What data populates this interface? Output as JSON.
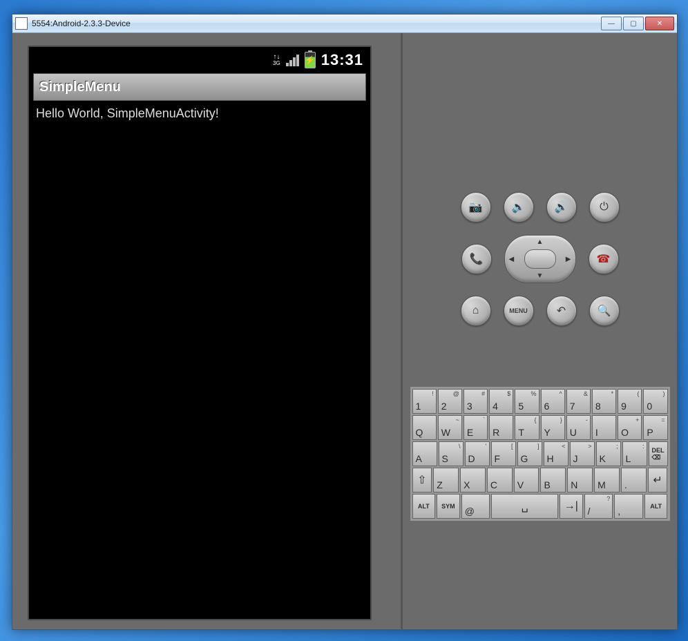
{
  "window": {
    "title": "5554:Android-2.3.3-Device"
  },
  "status": {
    "network_label": "3G",
    "clock": "13:31"
  },
  "app": {
    "title": "SimpleMenu",
    "body_text": "Hello World, SimpleMenuActivity!"
  },
  "hw": {
    "row1": [
      "camera",
      "vol-down",
      "vol-up",
      "power"
    ],
    "row3": [
      "home",
      "menu",
      "back",
      "search"
    ],
    "menu_label": "MENU"
  },
  "keyboard": {
    "row1": [
      {
        "m": "1",
        "s": "!"
      },
      {
        "m": "2",
        "s": "@"
      },
      {
        "m": "3",
        "s": "#"
      },
      {
        "m": "4",
        "s": "$"
      },
      {
        "m": "5",
        "s": "%"
      },
      {
        "m": "6",
        "s": "^"
      },
      {
        "m": "7",
        "s": "&"
      },
      {
        "m": "8",
        "s": "*"
      },
      {
        "m": "9",
        "s": "("
      },
      {
        "m": "0",
        "s": ")"
      }
    ],
    "row2": [
      {
        "m": "Q",
        "s": ""
      },
      {
        "m": "W",
        "s": "~"
      },
      {
        "m": "E",
        "s": "`"
      },
      {
        "m": "R",
        "s": ""
      },
      {
        "m": "T",
        "s": "{"
      },
      {
        "m": "Y",
        "s": "}"
      },
      {
        "m": "U",
        "s": "-"
      },
      {
        "m": "I",
        "s": ""
      },
      {
        "m": "O",
        "s": "+"
      },
      {
        "m": "P",
        "s": "="
      }
    ],
    "row3": [
      {
        "m": "A",
        "s": ""
      },
      {
        "m": "S",
        "s": "\\"
      },
      {
        "m": "D",
        "s": "'"
      },
      {
        "m": "F",
        "s": "["
      },
      {
        "m": "G",
        "s": "]"
      },
      {
        "m": "H",
        "s": "<"
      },
      {
        "m": "J",
        "s": ">"
      },
      {
        "m": "K",
        "s": ";"
      },
      {
        "m": "L",
        "s": ":"
      }
    ],
    "row4": [
      {
        "m": "Z",
        "s": ""
      },
      {
        "m": "X",
        "s": ""
      },
      {
        "m": "C",
        "s": ""
      },
      {
        "m": "V",
        "s": ""
      },
      {
        "m": "B",
        "s": ""
      },
      {
        "m": "N",
        "s": ""
      },
      {
        "m": "M",
        "s": ""
      },
      {
        "m": ".",
        "s": ""
      }
    ],
    "row5": {
      "alt": "ALT",
      "sym": "SYM",
      "at": "@",
      "slash": "/",
      "question": "?",
      "comma": ","
    },
    "del_label": "DEL"
  }
}
